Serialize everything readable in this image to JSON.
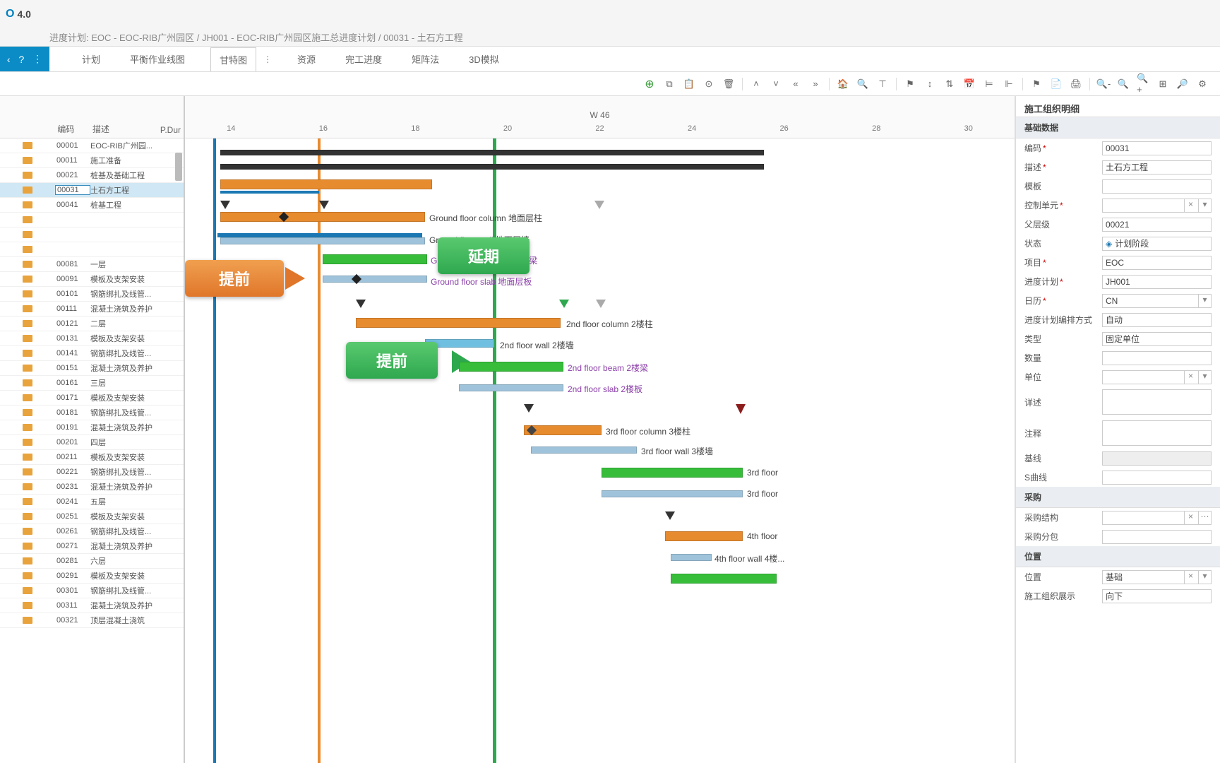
{
  "app": {
    "version_prefix": "O",
    "version": "4.0"
  },
  "breadcrumb": "进度计划: EOC - EOC-RIB广州园区 / JH001 - EOC-RIB广州园区施工总进度计划 / 00031 - 土石方工程",
  "menu_icons": {
    "back": "‹",
    "help": "?",
    "more": "⋮"
  },
  "tabs": [
    "计划",
    "平衡作业线图",
    "甘特图",
    "资源",
    "完工进度",
    "矩阵法",
    "3D模拟"
  ],
  "active_tab": 2,
  "toolbar_buttons": [
    "⊕",
    "⧉",
    "📋",
    "⊙",
    "🗑",
    "|",
    "˄",
    "˅",
    "«",
    "»",
    "|",
    "🏠",
    "🔍",
    "⊤",
    "|",
    "⚑",
    "↕",
    "⇅",
    "📅",
    "⊨",
    "⊩",
    "|",
    "⚑",
    "📄",
    "🖨",
    "|",
    "🔍-",
    "🔍",
    "🔍+",
    "⊞",
    "🔎",
    "⚙"
  ],
  "left_table": {
    "headers": {
      "code": "编码",
      "desc": "描述",
      "pdur": "P.Dur"
    },
    "rows": [
      {
        "code": "00001",
        "desc": "EOC-RIB广州园..."
      },
      {
        "code": "00011",
        "desc": "施工准备"
      },
      {
        "code": "00021",
        "desc": "桩基及基础工程"
      },
      {
        "code": "00031",
        "desc": "土石方工程",
        "selected": true
      },
      {
        "code": "00041",
        "desc": "桩基工程"
      },
      {
        "code": "",
        "desc": ""
      },
      {
        "code": "",
        "desc": ""
      },
      {
        "code": "",
        "desc": ""
      },
      {
        "code": "00081",
        "desc": "一层"
      },
      {
        "code": "00091",
        "desc": "模板及支架安装"
      },
      {
        "code": "00101",
        "desc": "钢筋绑扎及线管..."
      },
      {
        "code": "00111",
        "desc": "混凝土浇筑及养护"
      },
      {
        "code": "00121",
        "desc": "二层"
      },
      {
        "code": "00131",
        "desc": "模板及支架安装"
      },
      {
        "code": "00141",
        "desc": "钢筋绑扎及线管..."
      },
      {
        "code": "00151",
        "desc": "混凝土浇筑及养护"
      },
      {
        "code": "00161",
        "desc": "三层"
      },
      {
        "code": "00171",
        "desc": "模板及支架安装"
      },
      {
        "code": "00181",
        "desc": "钢筋绑扎及线管..."
      },
      {
        "code": "00191",
        "desc": "混凝土浇筑及养护"
      },
      {
        "code": "00201",
        "desc": "四层"
      },
      {
        "code": "00211",
        "desc": "模板及支架安装"
      },
      {
        "code": "00221",
        "desc": "钢筋绑扎及线管..."
      },
      {
        "code": "00231",
        "desc": "混凝土浇筑及养护"
      },
      {
        "code": "00241",
        "desc": "五层"
      },
      {
        "code": "00251",
        "desc": "模板及支架安装"
      },
      {
        "code": "00261",
        "desc": "钢筋绑扎及线管..."
      },
      {
        "code": "00271",
        "desc": "混凝土浇筑及养护"
      },
      {
        "code": "00281",
        "desc": "六层"
      },
      {
        "code": "00291",
        "desc": "模板及支架安装"
      },
      {
        "code": "00301",
        "desc": "钢筋绑扎及线管..."
      },
      {
        "code": "00311",
        "desc": "混凝土浇筑及养护"
      },
      {
        "code": "00321",
        "desc": "顶层混凝土浇筑"
      }
    ]
  },
  "gantt": {
    "week_label": "W 46",
    "days": [
      "14",
      "16",
      "18",
      "20",
      "22",
      "24",
      "26",
      "28",
      "30"
    ],
    "callouts": {
      "blue": {
        "text": "提前"
      },
      "orange": {
        "text": "提前"
      },
      "green1": {
        "text": "延期"
      },
      "green2": {
        "text": "提前"
      }
    },
    "labels": {
      "gf_column": "Ground floor column 地面层柱",
      "gf_wall": "Ground floor wall 地面层墙",
      "gf_beam": "Ground floor beam 地面层梁",
      "gf_slab": "Ground floor slab 地面层板",
      "f2_column": "2nd floor column 2楼柱",
      "f2_wall": "2nd floor wall 2楼墙",
      "f2_beam": "2nd floor beam 2楼梁",
      "f2_slab": "2nd floor slab 2楼板",
      "f3_column": "3rd floor column 3楼柱",
      "f3_wall": "3rd floor wall 3楼墙",
      "f3_a": "3rd floor",
      "f3_b": "3rd floor",
      "f4_a": "4th floor",
      "f4_wall": "4th floor wall 4楼..."
    }
  },
  "right": {
    "title": "施工组织明细",
    "sections": {
      "basic": "基础数据",
      "purchase": "采购",
      "location": "位置"
    },
    "fields": {
      "code": {
        "label": "编码",
        "value": "00031"
      },
      "desc": {
        "label": "描述",
        "value": "土石方工程"
      },
      "template": {
        "label": "模板",
        "value": ""
      },
      "ctrl_unit": {
        "label": "控制单元",
        "value": ""
      },
      "parent": {
        "label": "父层级",
        "value": "00021"
      },
      "status": {
        "label": "状态",
        "value": "计划阶段"
      },
      "project": {
        "label": "项目",
        "value": "EOC"
      },
      "schedule": {
        "label": "进度计划",
        "value": "JH001"
      },
      "calendar": {
        "label": "日历",
        "value": "CN"
      },
      "sched_method": {
        "label": "进度计划编排方式",
        "value": "自动"
      },
      "type": {
        "label": "类型",
        "value": "固定单位"
      },
      "quantity": {
        "label": "数量",
        "value": ""
      },
      "unit": {
        "label": "单位",
        "value": ""
      },
      "detail": {
        "label": "详述",
        "value": ""
      },
      "note": {
        "label": "注释",
        "value": ""
      },
      "baseline": {
        "label": "基线",
        "value": ""
      },
      "scurve": {
        "label": "S曲线",
        "value": ""
      },
      "purchase_struct": {
        "label": "采购结构",
        "value": ""
      },
      "purchase_pkg": {
        "label": "采购分包",
        "value": ""
      },
      "location": {
        "label": "位置",
        "value": "基础"
      },
      "org_display": {
        "label": "施工组织展示",
        "value": "向下"
      }
    }
  }
}
